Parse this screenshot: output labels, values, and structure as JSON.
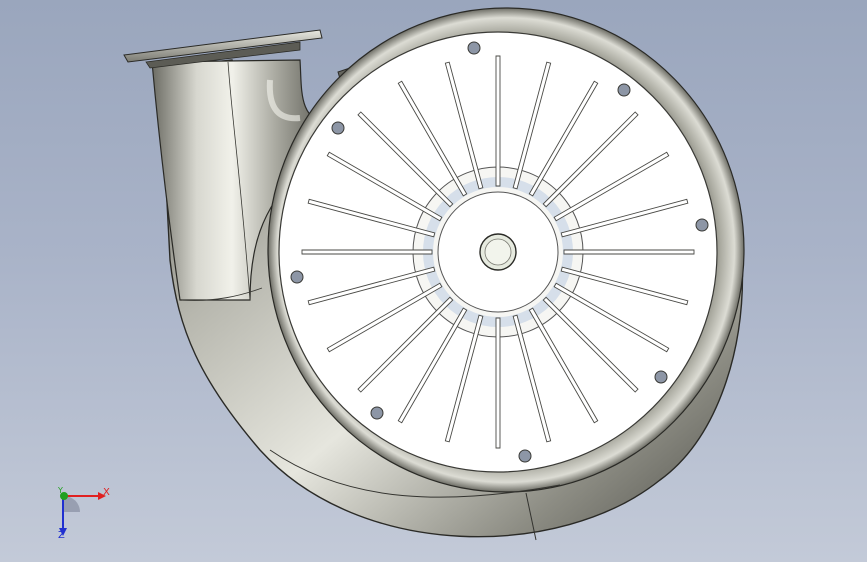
{
  "viewport": {
    "background_top": "#9aa6bd",
    "background_bottom": "#c3cad8"
  },
  "model": {
    "description_type": "centrifugal-fan-housing",
    "face_color": "#ffffff",
    "metal_color": "#8f8f86",
    "bolt_color": "#8d96a6"
  },
  "triad": {
    "x_label": "X",
    "y_label": "Y",
    "z_label": "Z",
    "x_color": "#e02020",
    "y_color": "#20a020",
    "z_color": "#2030d0"
  }
}
